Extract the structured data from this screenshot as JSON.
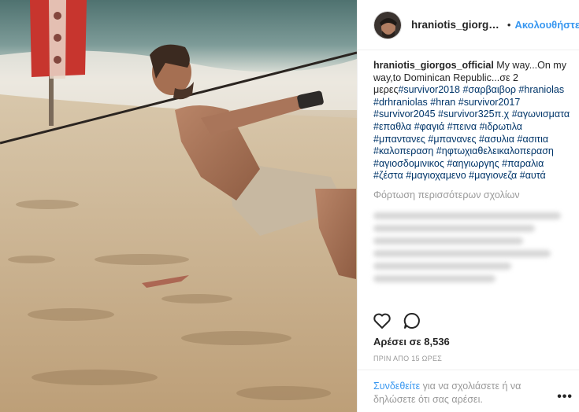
{
  "post": {
    "username": "hraniotis_giorgos_official",
    "follow_label": "Ακολουθήστε",
    "dot": "•",
    "caption_user": "hraniotis_giorgos_official",
    "caption_text": "My way...On my way,to Dominican Republic...σε 2 μερες",
    "hashtags": [
      "#survivor2018",
      "#σαρβαιβορ",
      "#hraniolas",
      "#drhraniolas",
      "#hran",
      "#survivor2017",
      "#survivor2045",
      "#survivor325π.χ",
      "#αγωνισματα",
      "#επαθλα",
      "#φαγιά",
      "#πεινα",
      "#ιδρωτιλα",
      "#μπαντανες",
      "#μπανανες",
      "#ασυλια",
      "#ασιτια",
      "#καλοπεραση",
      "#ηφτωχιαθελεικαλοπεραση",
      "#αγιοσδομινικος",
      "#αηγιωργης",
      "#παραλια",
      "#ζέστα",
      "#μαγιοχαμενο",
      "#μαγιονεζα",
      "#αυτά"
    ],
    "load_more_label": "Φόρτωση περισσότερων σχολίων",
    "likes": "Αρέσει σε 8,536",
    "time": "ΠΡΙΝ ΑΠΟ 15 ΩΡΕΣ",
    "login_link": "Συνδεθείτε",
    "login_text": " για να σχολιάσετε ή να δηλώσετε ότι σας αρέσει.",
    "more_options": "•••"
  },
  "icons": {
    "like": "heart-icon",
    "comment": "comment-icon",
    "more": "more-options-icon"
  },
  "colors": {
    "link": "#3897f0",
    "hashtag": "#003569",
    "muted": "#999999"
  }
}
